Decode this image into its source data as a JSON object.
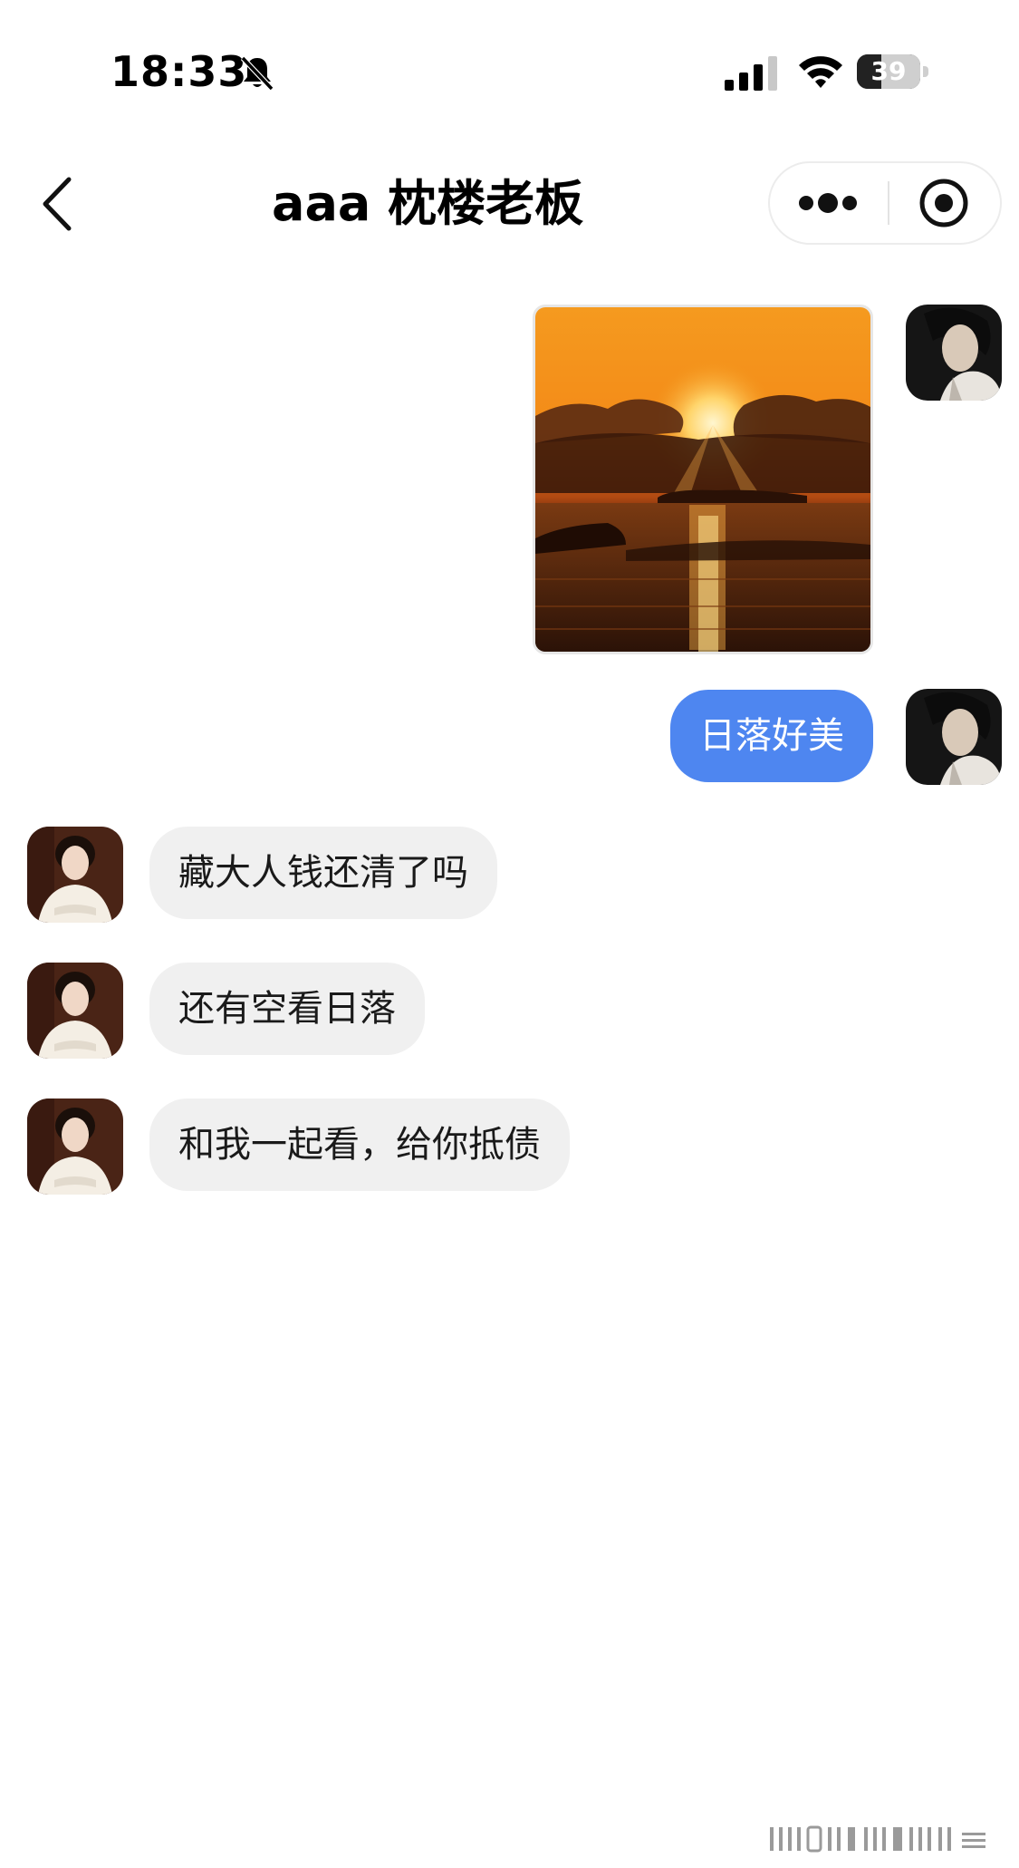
{
  "status_bar": {
    "time": "18:33",
    "battery_level": "39",
    "battery_fraction": 0.39,
    "icons": [
      "bell-slash-icon",
      "cellular-signal-icon",
      "wifi-icon",
      "battery-icon"
    ]
  },
  "header": {
    "back_icon": "chevron-left-icon",
    "title": "aaa 枕楼老板",
    "more_icon": "more-dots-icon",
    "close_icon": "target-circle-icon"
  },
  "messages": [
    {
      "sender": "self",
      "type": "image",
      "content": "sunset-over-sea-photo"
    },
    {
      "sender": "self",
      "type": "text",
      "text": "日落好美"
    },
    {
      "sender": "other",
      "type": "text",
      "text": "藏大人钱还清了吗"
    },
    {
      "sender": "other",
      "type": "text",
      "text": "还有空看日落"
    },
    {
      "sender": "other",
      "type": "text",
      "text": "和我一起看，给你抵债"
    }
  ],
  "colors": {
    "outgoing_bubble": "#4e86f0",
    "incoming_bubble": "#f0f0f0",
    "background": "#ffffff"
  }
}
